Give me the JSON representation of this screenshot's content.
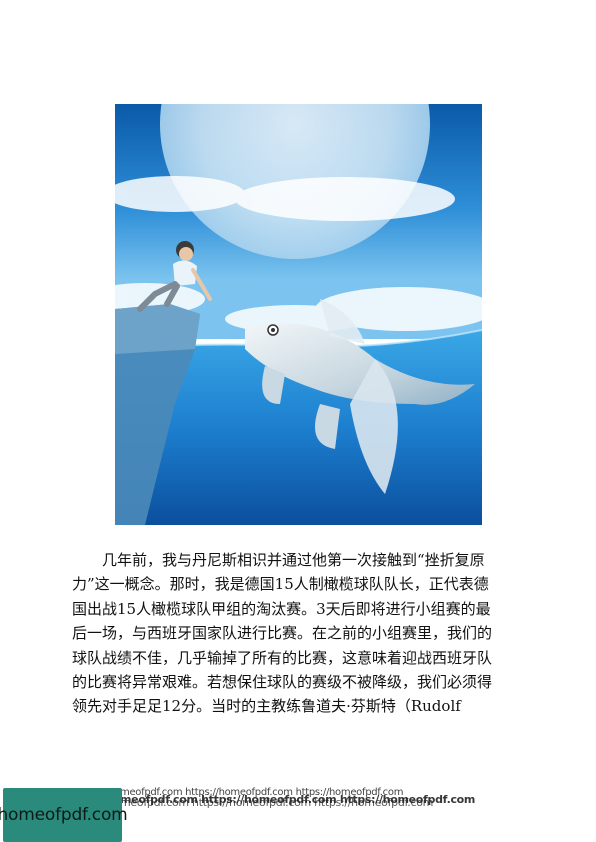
{
  "paragraph": {
    "lines": [
      "几年前，我与丹尼斯相识并通过他第一次接触到“挫折复原",
      "力”这一概念。那时，我是德国15人制橄榄球队队长，正代表德",
      "国出战15人橄榄球队甲组的淘汰赛。3天后即将进行小组赛的最",
      "后一场，与西班牙国家队进行比赛。在之前的小组赛里，我们的",
      "球队战绩不佳，几乎输掉了所有的比赛，这意味着迎战西班牙队",
      "的比赛将异常艰难。若想保住球队的赛级不被降级，我们必须得",
      "领先对手足足12分。当时的主教练鲁道夫·芬斯特（Rudolf"
    ]
  },
  "watermark": {
    "line1": "meofpdf.com https://homeofpdf.com https://homeofpdf.com",
    "line2": "meofpdf.com https://homeofpdf.com https://homeofpdf.com",
    "line3": "meofpdf.com https://homeofpdf.com https://homeofpdf.com"
  },
  "logo": {
    "text": "homeofpdf.com",
    "color": "#2a8a7c"
  },
  "colors": {
    "sky_top": "#0a5aa8",
    "sky_mid": "#2f8fd8",
    "water_deep": "#0b4f9e",
    "water_light": "#3aa7e6"
  }
}
